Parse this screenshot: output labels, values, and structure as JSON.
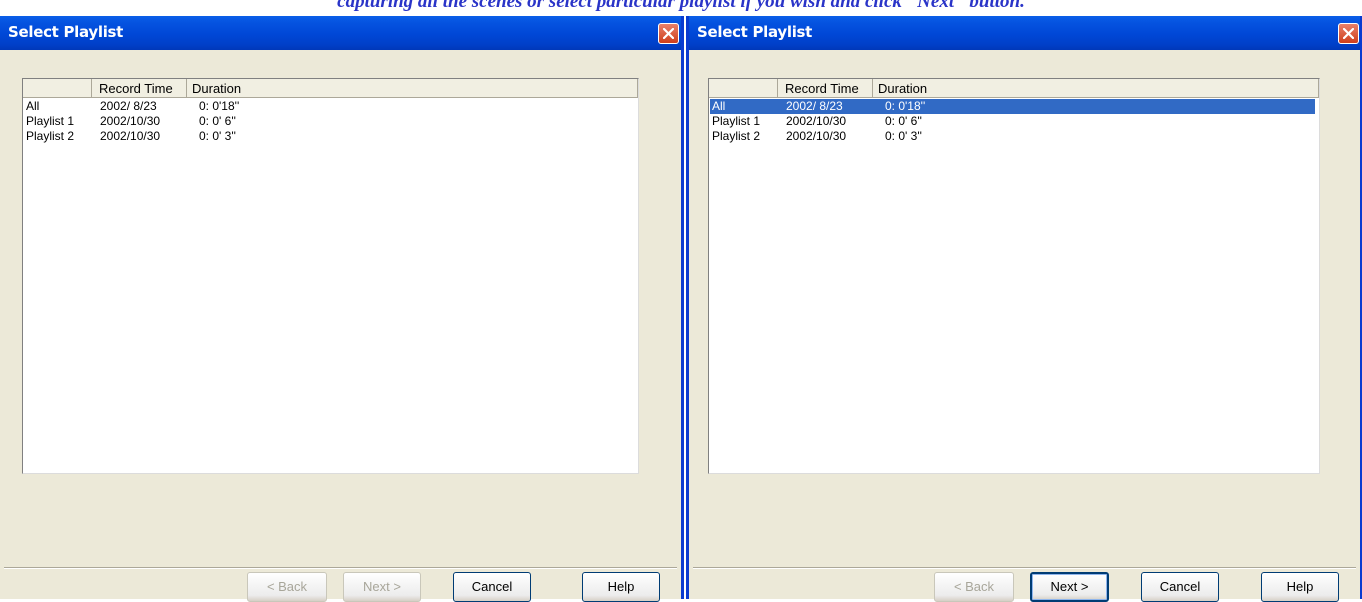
{
  "caption": "capturing all the scenes or select particular playlist if you wish and click \"Next\" button.",
  "dialogs": [
    {
      "title": "Select Playlist",
      "columns": [
        "",
        "Record Time",
        "Duration"
      ],
      "rows": [
        {
          "name": "All",
          "record_time": "2002/ 8/23",
          "duration": "0: 0'18''",
          "selected": false
        },
        {
          "name": "Playlist 1",
          "record_time": "2002/10/30",
          "duration": "0: 0' 6''",
          "selected": false
        },
        {
          "name": "Playlist 2",
          "record_time": "2002/10/30",
          "duration": "0: 0' 3''",
          "selected": false
        }
      ],
      "buttons": {
        "back": "< Back",
        "next": "Next >",
        "cancel": "Cancel",
        "help": "Help"
      },
      "next_enabled": false
    },
    {
      "title": "Select Playlist",
      "columns": [
        "",
        "Record Time",
        "Duration"
      ],
      "rows": [
        {
          "name": "All",
          "record_time": "2002/ 8/23",
          "duration": "0: 0'18''",
          "selected": true
        },
        {
          "name": "Playlist 1",
          "record_time": "2002/10/30",
          "duration": "0: 0' 6''",
          "selected": false
        },
        {
          "name": "Playlist 2",
          "record_time": "2002/10/30",
          "duration": "0: 0' 3''",
          "selected": false
        }
      ],
      "buttons": {
        "back": "< Back",
        "next": "Next >",
        "cancel": "Cancel",
        "help": "Help"
      },
      "next_enabled": true
    }
  ],
  "colors": {
    "titlebar": "#0047d6",
    "dialog_bg": "#ece9d8",
    "selection": "#316ac5",
    "caption": "#2a34c8",
    "close_button": "#cf3e1b"
  }
}
